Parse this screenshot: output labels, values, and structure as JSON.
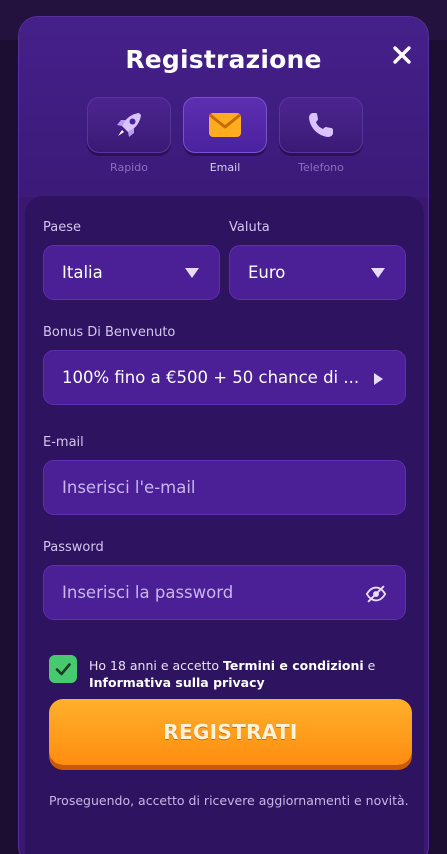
{
  "modal": {
    "title": "Registrazione",
    "close_icon": "close-icon"
  },
  "tabs": [
    {
      "label": "Rapido",
      "icon": "rocket-icon",
      "active": false
    },
    {
      "label": "Email",
      "icon": "envelope-icon",
      "active": true
    },
    {
      "label": "Telefono",
      "icon": "phone-icon",
      "active": false
    }
  ],
  "form": {
    "country": {
      "label": "Paese",
      "value": "Italia"
    },
    "currency": {
      "label": "Valuta",
      "value": "Euro"
    },
    "bonus": {
      "label": "Bonus Di Benvenuto",
      "value": "100% fino a €500 + 50 chance di ..."
    },
    "email": {
      "label": "E-mail",
      "placeholder": "Inserisci l'e-mail"
    },
    "password": {
      "label": "Password",
      "placeholder": "Inserisci la password",
      "icon": "eye-off-icon"
    },
    "terms": {
      "checked": true,
      "text_1": "Ho 18 anni e accetto ",
      "link_1": "Termini e condizioni",
      "text_2": " e ",
      "link_2": "Informativa sulla privacy"
    },
    "submit_label": "REGISTRATI",
    "footer_note": "Proseguendo, accetto di ricevere aggiornamenti e novità."
  },
  "colors": {
    "accent": "#ff9a1a",
    "card": "#2e1360",
    "field": "#4b1f96",
    "check": "#47c96f"
  }
}
